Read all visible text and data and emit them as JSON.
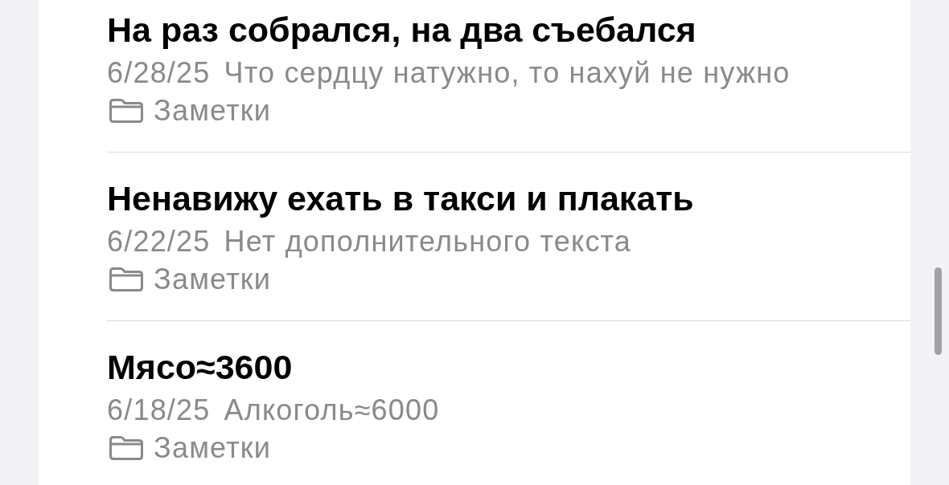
{
  "notes": [
    {
      "title": "На раз собрался, на два съебался",
      "date": "6/28/25",
      "preview": "Что сердцу натужно, то нахуй не нужно",
      "folder": "Заметки"
    },
    {
      "title": "Ненавижу ехать в такси и плакать",
      "date": "6/22/25",
      "preview": "Нет дополнительного текста",
      "folder": "Заметки"
    },
    {
      "title": "Мясо≈3600",
      "date": "6/18/25",
      "preview": "Алкоголь≈6000",
      "folder": "Заметки"
    }
  ]
}
